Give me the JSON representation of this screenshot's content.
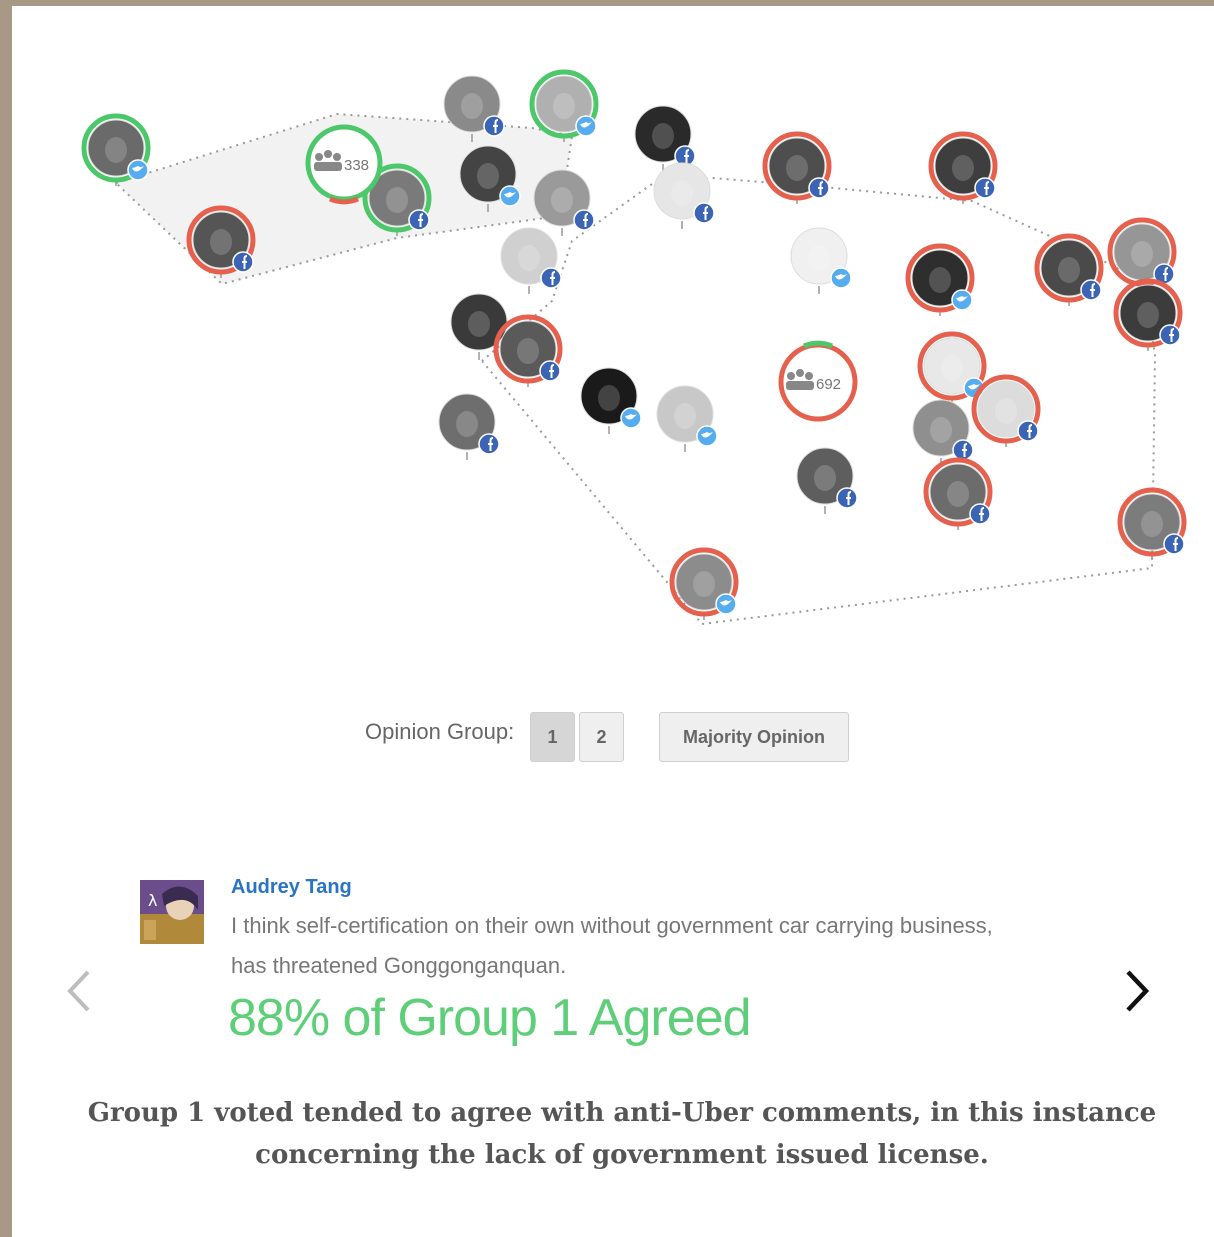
{
  "colors": {
    "agree_ring": "#4cc76a",
    "disagree_ring": "#e5604d",
    "facebook_badge": "#3b64b5",
    "twitter_badge": "#55acee",
    "hull_stroke": "#999999",
    "hull_fill": "#f2f2f2",
    "author_link": "#2a74c6",
    "stat_text": "#5ecf78"
  },
  "groups": [
    {
      "name": "group-1",
      "count": "338"
    },
    {
      "name": "group-2",
      "count": "692"
    }
  ],
  "avatars": [
    {
      "id": "p1",
      "ring": "green",
      "badge": "twitter",
      "shade": "#6a6a6a"
    },
    {
      "id": "p2",
      "ring": "red",
      "badge": "facebook",
      "shade": "#555555"
    },
    {
      "id": "p3",
      "ring": "none",
      "badge": "facebook",
      "shade": "#8a8a8a"
    },
    {
      "id": "p4",
      "ring": "green",
      "badge": "twitter",
      "shade": "#b0b0b0"
    },
    {
      "id": "p5",
      "ring": "green",
      "badge": "facebook",
      "shade": "#7a7a7a"
    },
    {
      "id": "p6",
      "ring": "none",
      "badge": "twitter",
      "shade": "#444444"
    },
    {
      "id": "p7",
      "ring": "none",
      "badge": "facebook",
      "shade": "#9a9a9a"
    },
    {
      "id": "p8",
      "ring": "none",
      "badge": "facebook",
      "shade": "#d0d0d0"
    },
    {
      "id": "p9",
      "ring": "none",
      "badge": "facebook",
      "shade": "#2a2a2a"
    },
    {
      "id": "p10",
      "ring": "none",
      "badge": "facebook",
      "shade": "#e6e6e6"
    },
    {
      "id": "p11",
      "ring": "none",
      "badge": "none",
      "shade": "#3a3a3a"
    },
    {
      "id": "p12",
      "ring": "red",
      "badge": "facebook",
      "shade": "#5a5a5a"
    },
    {
      "id": "p13",
      "ring": "none",
      "badge": "facebook",
      "shade": "#6e6e6e"
    },
    {
      "id": "p14",
      "ring": "none",
      "badge": "twitter",
      "shade": "#1a1a1a"
    },
    {
      "id": "p15",
      "ring": "none",
      "badge": "twitter",
      "shade": "#c8c8c8"
    },
    {
      "id": "p16",
      "ring": "red",
      "badge": "twitter",
      "shade": "#8c8c8c"
    },
    {
      "id": "p17",
      "ring": "red",
      "badge": "facebook",
      "shade": "#4e4e4e"
    },
    {
      "id": "p18",
      "ring": "none",
      "badge": "twitter",
      "shade": "#f0f0f0"
    },
    {
      "id": "p19",
      "ring": "red",
      "badge": "facebook",
      "shade": "#3e3e3e"
    },
    {
      "id": "p20",
      "ring": "red",
      "badge": "twitter",
      "shade": "#2e2e2e"
    },
    {
      "id": "p21",
      "ring": "none",
      "badge": "facebook",
      "shade": "#5e5e5e"
    },
    {
      "id": "p22",
      "ring": "red",
      "badge": "twitter",
      "shade": "#e8e8e8"
    },
    {
      "id": "p23",
      "ring": "none",
      "badge": "facebook",
      "shade": "#8f8f8f"
    },
    {
      "id": "p24",
      "ring": "red",
      "badge": "facebook",
      "shade": "#dcdcdc"
    },
    {
      "id": "p25",
      "ring": "red",
      "badge": "facebook",
      "shade": "#6c6c6c"
    },
    {
      "id": "p26",
      "ring": "red",
      "badge": "facebook",
      "shade": "#4a4a4a"
    },
    {
      "id": "p27",
      "ring": "red",
      "badge": "facebook",
      "shade": "#969696"
    },
    {
      "id": "p28",
      "ring": "red",
      "badge": "facebook",
      "shade": "#3c3c3c"
    },
    {
      "id": "p29",
      "ring": "red",
      "badge": "facebook",
      "shade": "#7c7c7c"
    }
  ],
  "controls": {
    "label": "Opinion Group:",
    "group_1": "1",
    "group_2": "2",
    "majority": "Majority Opinion"
  },
  "comment": {
    "author": "Audrey Tang",
    "text": "I think self-certification on their own without government car carrying business, has threatened Gonggonganquan.",
    "stat": "88% of Group 1 Agreed",
    "prev_icon": "chevron-left-icon",
    "next_icon": "chevron-right-icon"
  },
  "caption": "Group 1 voted tended to agree with anti-Uber comments, in this instance concerning the lack of government issued license."
}
